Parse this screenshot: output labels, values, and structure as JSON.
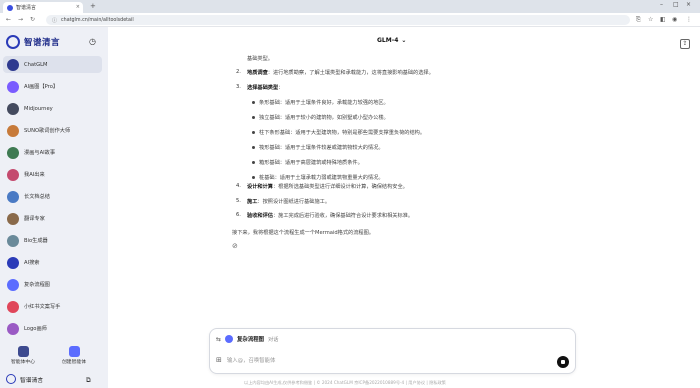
{
  "browser": {
    "tab_title": "智谱清言",
    "url": "chatglm.cn/main/alltoolsdetail",
    "new_tab": "+",
    "close": "×"
  },
  "sidebar": {
    "brand": "智谱清言",
    "items": [
      {
        "label": "ChatGLM",
        "color": "#2f3a8f"
      },
      {
        "label": "AI画图【Pro】",
        "color": "#7a5cff"
      },
      {
        "label": "Midjourney",
        "color": "#444a5e"
      },
      {
        "label": "SUNO歌词创作大师",
        "color": "#c77a3a"
      },
      {
        "label": "漫画与AI故事",
        "color": "#3e7a52"
      },
      {
        "label": "我AI出来",
        "color": "#c44a6e"
      },
      {
        "label": "长文档总结",
        "color": "#4a7ac4"
      },
      {
        "label": "翻译专家",
        "color": "#8a6a4a"
      },
      {
        "label": "Bio生成器",
        "color": "#6a8a9a"
      },
      {
        "label": "AI搜索",
        "color": "#2b3bb8"
      },
      {
        "label": "复杂流程图",
        "color": "#5b6cff"
      },
      {
        "label": "小红书文案写手",
        "color": "#e0465a"
      },
      {
        "label": "Logo画师",
        "color": "#9a5ac4"
      }
    ],
    "agent_center": "智能体中心",
    "create_agent": "创建智能体",
    "user_name": "智谱清言"
  },
  "main": {
    "model": "GLM-4",
    "lines": {
      "l0": "基础类型。",
      "l1_title": "地质调查",
      "l1_text": "：进行地质勘察，了解土壤类型和承载能力，这将直接影响基础的选择。",
      "l2_title": "选择基础类型",
      "b1": "条形基础：适用于土壤条件良好，承载能力较强的地区。",
      "b2": "独立基础：适用于较小的建筑物，如别墅或小型办公楼。",
      "b3": "柱下条形基础：适用于大型建筑物，特别是那些需要支撑重负荷的结构。",
      "b4": "筏形基础：适用于土壤条件较差或建筑物较大的情况。",
      "b5": "箱形基础：适用于高层建筑或特殊地质条件。",
      "b6": "桩基础：适用于土壤承载力弱或建筑物重量大的情况。",
      "l4_title": "设计和计算",
      "l4_text": "：根据所选基础类型进行详细设计和计算，确保结构安全。",
      "l5_title": "施工",
      "l5_text": "：按照设计图纸进行基础施工。",
      "l6_title": "验收和评估",
      "l6_text": "：施工完成后进行验收，确保基础符合设计要求和相关标准。",
      "closing": "接下来，我将根据这个流程生成一个Mermaid格式的流程图。"
    }
  },
  "input": {
    "agent": "复杂流程图",
    "chat": "对话",
    "placeholder": "输入@，召唤智能体"
  },
  "footer": "以上内容均由AI生成,仅供参考和借鉴 | © 2024 ChatGLM 京ICP备2022010889号-4 | 用户协议 | 隐私政策"
}
